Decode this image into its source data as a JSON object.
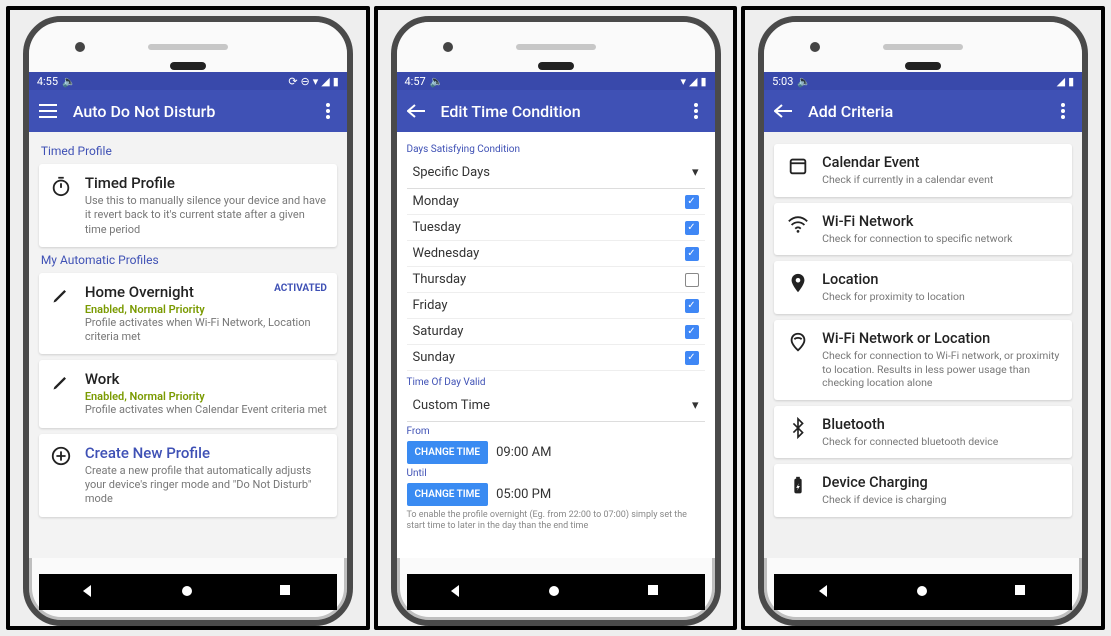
{
  "screens": {
    "s1": {
      "status": {
        "time": "4:55"
      },
      "appbar": {
        "title": "Auto Do Not Disturb"
      },
      "section_timed_label": "Timed Profile",
      "timed_card": {
        "title": "Timed Profile",
        "desc": "Use this to manually silence your device and have it revert back to it's current state after a given time period"
      },
      "section_auto_label": "My Automatic Profiles",
      "profile_home": {
        "title": "Home Overnight",
        "badge": "ACTIVATED",
        "status": "Enabled, Normal Priority",
        "desc": "Profile activates when Wi-Fi Network, Location criteria met"
      },
      "profile_work": {
        "title": "Work",
        "status": "Enabled, Normal Priority",
        "desc": "Profile activates when Calendar Event criteria met"
      },
      "create_profile": {
        "title": "Create New Profile",
        "desc": "Create a new profile that automatically adjusts your device's ringer mode and \"Do Not Disturb\" mode"
      }
    },
    "s2": {
      "status": {
        "time": "4:57"
      },
      "appbar": {
        "title": "Edit Time Condition"
      },
      "days_label": "Days Satisfying Condition",
      "days_select": "Specific Days",
      "days": [
        {
          "name": "Monday",
          "checked": true
        },
        {
          "name": "Tuesday",
          "checked": true
        },
        {
          "name": "Wednesday",
          "checked": true
        },
        {
          "name": "Thursday",
          "checked": false
        },
        {
          "name": "Friday",
          "checked": true
        },
        {
          "name": "Saturday",
          "checked": true
        },
        {
          "name": "Sunday",
          "checked": true
        }
      ],
      "time_label": "Time Of Day Valid",
      "time_select": "Custom Time",
      "from_label": "From",
      "until_label": "Until",
      "change_time": "CHANGE TIME",
      "from_value": "09:00 AM",
      "until_value": "05:00 PM",
      "hint": "To enable the profile overnight (Eg. from 22:00 to 07:00) simply set the start time to later in the day than the end time"
    },
    "s3": {
      "status": {
        "time": "5:03"
      },
      "appbar": {
        "title": "Add Criteria"
      },
      "items": [
        {
          "title": "Calendar Event",
          "desc": "Check if currently in a calendar event"
        },
        {
          "title": "Wi-Fi Network",
          "desc": "Check for connection to specific network"
        },
        {
          "title": "Location",
          "desc": "Check for proximity to location"
        },
        {
          "title": "Wi-Fi Network or Location",
          "desc": "Check for connection to Wi-Fi network, or proximity to location. Results in less power usage than checking location alone"
        },
        {
          "title": "Bluetooth",
          "desc": "Check for connected bluetooth device"
        },
        {
          "title": "Device Charging",
          "desc": "Check if device is charging"
        }
      ]
    }
  }
}
